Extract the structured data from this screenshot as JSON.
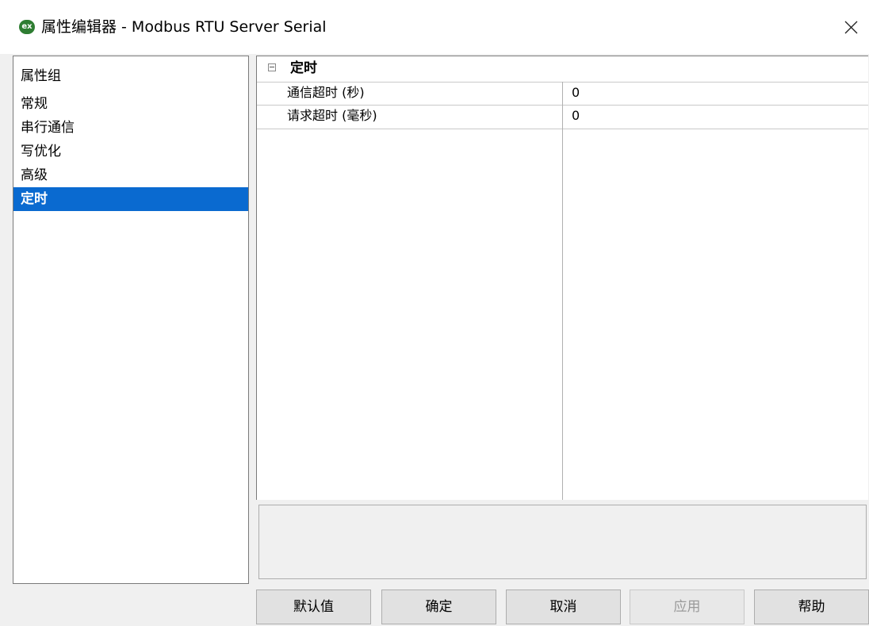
{
  "window": {
    "title": "属性编辑器 - Modbus RTU Server Serial",
    "app_icon_label": "ex",
    "icon_color": "#2e7d32"
  },
  "sidebar": {
    "header": "属性组",
    "items": [
      {
        "label": "常规"
      },
      {
        "label": "串行通信"
      },
      {
        "label": "写优化"
      },
      {
        "label": "高级"
      },
      {
        "label": "定时",
        "selected": true
      }
    ],
    "selected_color": "#0a6ad0"
  },
  "property_grid": {
    "category": "定时",
    "rows": [
      {
        "name": "通信超时 (秒)",
        "value": "0"
      },
      {
        "name": "请求超时 (毫秒)",
        "value": "0"
      }
    ]
  },
  "buttons": {
    "default_label": "默认值",
    "ok_label": "确定",
    "cancel_label": "取消",
    "apply_label": "应用",
    "help_label": "帮助"
  }
}
